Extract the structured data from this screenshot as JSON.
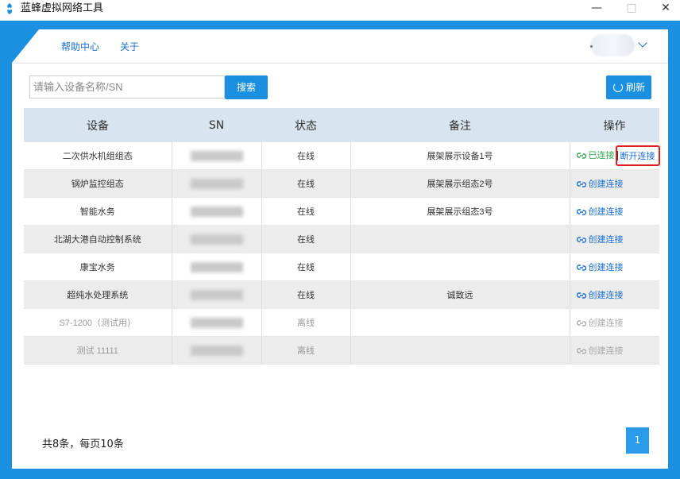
{
  "window": {
    "title": "蓝蜂虚拟网络工具",
    "minimize": "—",
    "maximize": "□",
    "close": "✕"
  },
  "nav": {
    "help": "帮助中心",
    "about": "关于"
  },
  "search": {
    "placeholder": "请输入设备名称/SN",
    "button": "搜索"
  },
  "refresh": {
    "label": "刷新"
  },
  "table": {
    "headers": {
      "device": "设备",
      "sn": "SN",
      "status": "状态",
      "remark": "备注",
      "action": "操作"
    },
    "rows": [
      {
        "device": "二次供水机组组态",
        "status": "在线",
        "remark": "展架展示设备1号",
        "action": "已连接",
        "action2": "断开连接"
      },
      {
        "device": "锅炉监控组态",
        "status": "在线",
        "remark": "展架展示组态2号",
        "action": "创建连接"
      },
      {
        "device": "智能水务",
        "status": "在线",
        "remark": "展架展示组态3号",
        "action": "创建连接"
      },
      {
        "device": "北湖大港自动控制系统",
        "status": "在线",
        "remark": "",
        "action": "创建连接"
      },
      {
        "device": "康宝水务",
        "status": "在线",
        "remark": "",
        "action": "创建连接"
      },
      {
        "device": "超纯水处理系统",
        "status": "在线",
        "remark": "诚致远",
        "action": "创建连接"
      },
      {
        "device": "S7-1200（测试用）",
        "status": "离线",
        "remark": "",
        "action": "创建连接"
      },
      {
        "device": "测试 11111",
        "status": "离线",
        "remark": "",
        "action": "创建连接"
      }
    ]
  },
  "footer": {
    "summary": "共8条，每页10条",
    "page": "1"
  },
  "colors": {
    "accent": "#1b8fe0",
    "connected": "#2fa84f",
    "highlight_border": "#e02020"
  }
}
